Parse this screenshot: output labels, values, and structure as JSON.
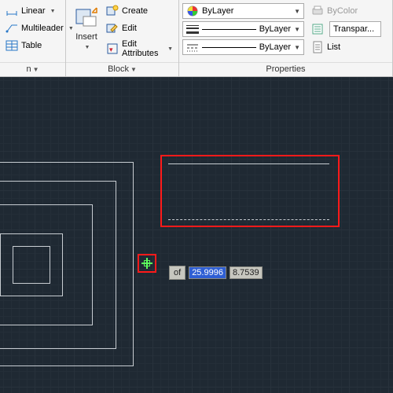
{
  "ribbon": {
    "annotation": {
      "title": "n",
      "linear": "Linear",
      "multileader": "Multileader",
      "table": "Table"
    },
    "block": {
      "title": "Block",
      "insert": "Insert",
      "create": "Create",
      "edit": "Edit",
      "edit_attributes": "Edit Attributes"
    },
    "properties": {
      "title": "Properties",
      "layer": "ByLayer",
      "linetype": "ByLayer",
      "lineweight": "ByLayer",
      "bycolor": "ByColor",
      "list": "List",
      "transparency": "Transpar..."
    }
  },
  "canvas": {
    "tracking_label": "of",
    "x_value": "25.9996",
    "y_value": "8.7539"
  }
}
